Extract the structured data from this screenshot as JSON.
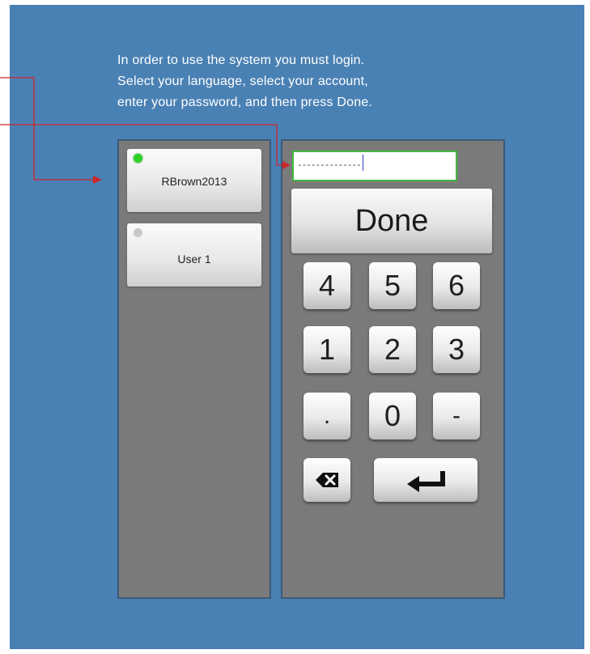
{
  "instructions": {
    "line1": "In order to use the system you must login.",
    "line2": "Select your language, select your account,",
    "line3": "enter your password, and then press Done."
  },
  "accounts": [
    {
      "name": "RBrown2013",
      "selected": true
    },
    {
      "name": "User 1",
      "selected": false
    }
  ],
  "password": {
    "masked_value": "--------------"
  },
  "keypad": {
    "done_label": "Done",
    "keys": [
      "4",
      "5",
      "6",
      "1",
      "2",
      "3",
      ".",
      "0",
      "-"
    ],
    "backspace_icon": "backspace-icon",
    "enter_icon": "enter-arrow-icon"
  },
  "colors": {
    "background": "#4a81b4",
    "panel": "#7a7a7a",
    "selected_indicator": "#2fd02a",
    "field_border": "#41b83f",
    "annotation_arrow": "#d0252a"
  }
}
